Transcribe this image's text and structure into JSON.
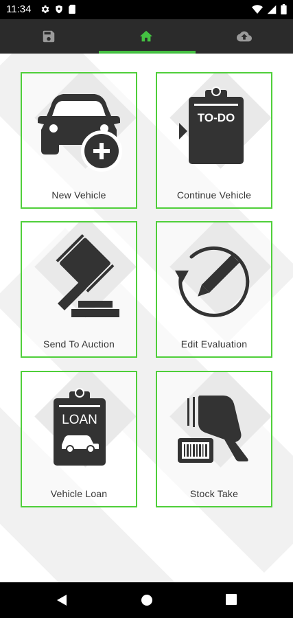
{
  "status_bar": {
    "time": "11:34",
    "left_icons": [
      "gear-icon",
      "shield-icon",
      "sim-icon"
    ],
    "right_icons": [
      "wifi-icon",
      "signal-icon",
      "battery-icon"
    ]
  },
  "tabs": [
    {
      "icon": "save-icon",
      "active": false
    },
    {
      "icon": "home-icon",
      "active": true
    },
    {
      "icon": "cloud-upload-icon",
      "active": false
    }
  ],
  "colors": {
    "accent": "#44c042",
    "card_border": "#4fcf3a",
    "tab_bar": "#2b2b2b",
    "icon_dark": "#333333"
  },
  "cards": [
    {
      "label": "New Vehicle",
      "icon": "car-add-icon"
    },
    {
      "label": "Continue Vehicle",
      "icon": "todo-clipboard-icon",
      "icon_text": "TO-DO"
    },
    {
      "label": "Send To Auction",
      "icon": "gavel-icon"
    },
    {
      "label": "Edit Evaluation",
      "icon": "edit-refresh-icon"
    },
    {
      "label": "Vehicle Loan",
      "icon": "loan-clipboard-icon",
      "icon_text": "LOAN"
    },
    {
      "label": "Stock Take",
      "icon": "barcode-scanner-icon"
    }
  ],
  "nav_bar": [
    "back-icon",
    "home-circle-icon",
    "recents-icon"
  ]
}
